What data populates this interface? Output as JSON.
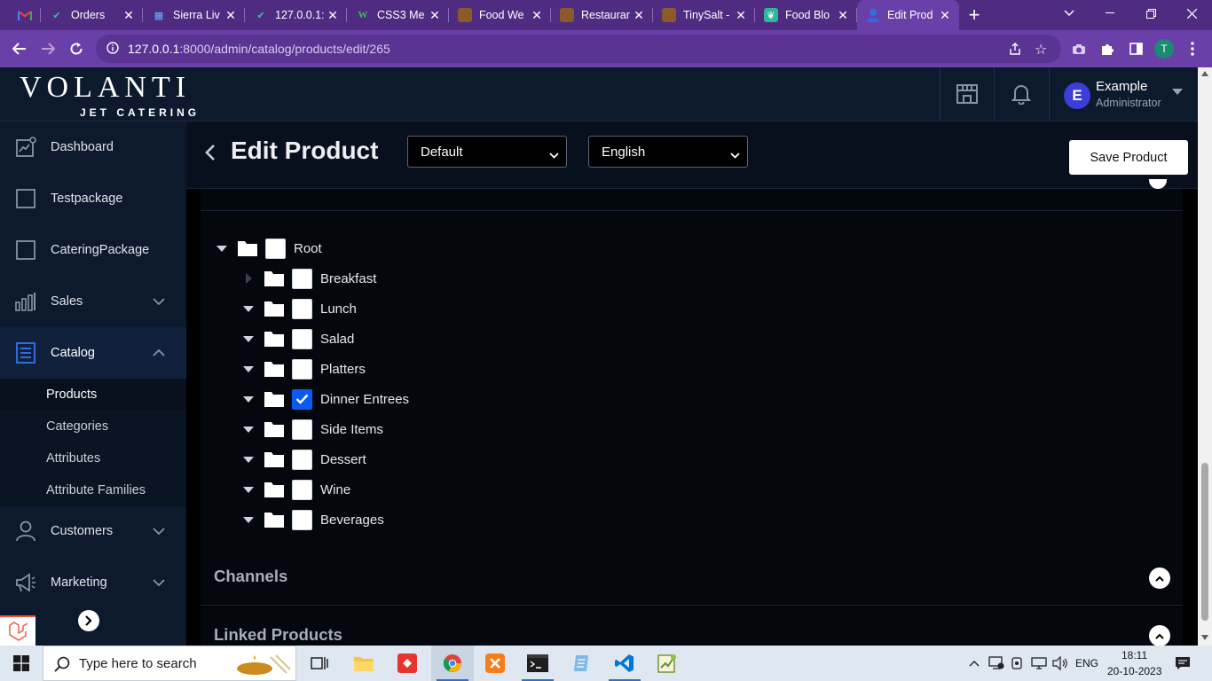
{
  "browser": {
    "tabs": [
      {
        "label": "",
        "favicon": "gmail-icon",
        "active": false
      },
      {
        "label": "Orders",
        "favicon": "check-icon",
        "active": false
      },
      {
        "label": "Sierra Liv",
        "favicon": "grid-icon",
        "active": false
      },
      {
        "label": "127.0.0.1:",
        "favicon": "check-icon",
        "active": false
      },
      {
        "label": "CSS3 Me",
        "favicon": "w-icon",
        "active": false
      },
      {
        "label": "Food We",
        "favicon": "food-icon",
        "active": false
      },
      {
        "label": "Restaurar",
        "favicon": "food-icon",
        "active": false
      },
      {
        "label": "TinySalt -",
        "favicon": "food-icon",
        "active": false
      },
      {
        "label": "Food Blo",
        "favicon": "leaf-icon",
        "active": false
      },
      {
        "label": "Edit Prod",
        "favicon": "user-icon",
        "active": true
      }
    ],
    "url_host": "127.0.0.1",
    "url_path": ":8000/admin/catalog/products/edit/265",
    "profile_initial": "T"
  },
  "header": {
    "logo_main": "VOLANTI",
    "logo_sub": "JET CATERING",
    "user_initial": "E",
    "user_name": "Example",
    "user_role": "Administrator"
  },
  "sidebar": {
    "items": [
      {
        "label": "Dashboard"
      },
      {
        "label": "Testpackage"
      },
      {
        "label": "CateringPackage"
      },
      {
        "label": "Sales"
      },
      {
        "label": "Catalog"
      },
      {
        "label": "Customers"
      },
      {
        "label": "Marketing"
      }
    ],
    "catalog_sub": [
      "Products",
      "Categories",
      "Attributes",
      "Attribute Families"
    ]
  },
  "page": {
    "title": "Edit Product",
    "channel_select": "Default",
    "locale_select": "English",
    "save_label": "Save Product"
  },
  "tree": {
    "root": "Root",
    "children": [
      {
        "label": "Breakfast",
        "checked": false,
        "expanded": false
      },
      {
        "label": "Lunch",
        "checked": false,
        "expanded": true
      },
      {
        "label": "Salad",
        "checked": false,
        "expanded": true
      },
      {
        "label": "Platters",
        "checked": false,
        "expanded": true
      },
      {
        "label": "Dinner Entrees",
        "checked": true,
        "expanded": true
      },
      {
        "label": "Side Items",
        "checked": false,
        "expanded": true
      },
      {
        "label": "Dessert",
        "checked": false,
        "expanded": true
      },
      {
        "label": "Wine",
        "checked": false,
        "expanded": true
      },
      {
        "label": "Beverages",
        "checked": false,
        "expanded": true
      }
    ]
  },
  "panels": {
    "channels": "Channels",
    "linked_products": "Linked Products"
  },
  "taskbar": {
    "search_placeholder": "Type here to search",
    "lang": "ENG",
    "time": "18:11",
    "date": "20-10-2023"
  },
  "colors": {
    "browser_frame": "#4f2c82",
    "browser_toolbar": "#6b3fa8",
    "app_header": "#0d1a2e",
    "check_accent": "#0a5cf0"
  }
}
